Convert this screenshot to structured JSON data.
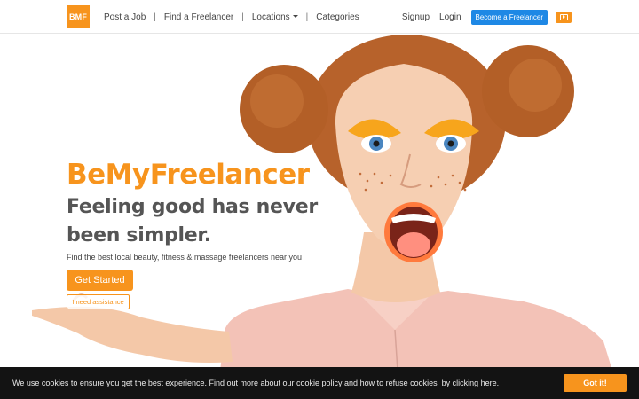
{
  "navbar": {
    "logo_text": "BMF",
    "links": [
      {
        "label": "Post a Job"
      },
      {
        "label": "Find a Freelancer"
      },
      {
        "label": "Locations"
      },
      {
        "label": "Categories"
      }
    ],
    "signup_label": "Signup",
    "login_label": "Login",
    "become_freelancer_label": "Become a Freelancer",
    "video_icon": "play-video-icon"
  },
  "hero": {
    "title": "BeMyFreelancer",
    "subtitle": "Feeling good has never been simpler.",
    "description": "Find the best local beauty, fitness & massage freelancers near you",
    "get_started_label": "Get Started",
    "assistance_label": "I need assistance"
  },
  "cookie_bar": {
    "text": "We use cookies to ensure you get the best experience. Find out more about our cookie policy and how to refuse cookies",
    "link_label": "by clicking here.",
    "button_label": "Got it!"
  },
  "colors": {
    "accent": "#f7941d",
    "primary_button": "#1e88e5",
    "cookie_bar_bg": "#131313"
  }
}
